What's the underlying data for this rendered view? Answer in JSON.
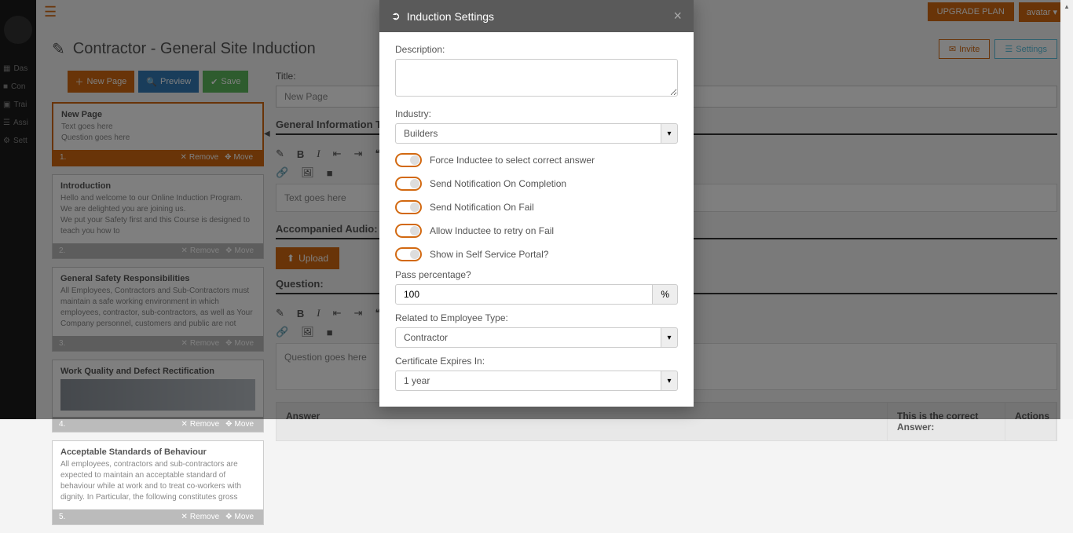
{
  "topbar": {
    "upgrade": "UPGRADE PLAN",
    "avatar": "avatar ▾"
  },
  "sidebar": {
    "items": [
      {
        "icon": "▦",
        "label": "Das"
      },
      {
        "icon": "■",
        "label": "Con"
      },
      {
        "icon": "▣",
        "label": "Trai"
      },
      {
        "icon": "☰",
        "label": "Assi"
      },
      {
        "icon": "⚙",
        "label": "Sett"
      }
    ]
  },
  "page": {
    "title": "Contractor - General Site Induction"
  },
  "title_actions": {
    "invite": "Invite",
    "settings": "Settings"
  },
  "left_toolbar": {
    "new_page": "New Page",
    "preview": "Preview",
    "save": "Save"
  },
  "cards": [
    {
      "num": "1.",
      "title": "New Page",
      "lines": [
        "Text goes here",
        "Question goes here"
      ],
      "active": true
    },
    {
      "num": "2.",
      "title": "Introduction",
      "lines": [
        "Hello and welcome to our Online Induction Program. We are delighted you are joining us.",
        "We put your Safety first and this Course is designed to teach you how to"
      ]
    },
    {
      "num": "3.",
      "title": "General Safety Responsibilities",
      "lines": [
        "All Employees, Contractors and Sub-Contractors must maintain a safe working environment in which employees, contractor, sub-contractors, as well as Your Company personnel, customers and public are not"
      ]
    },
    {
      "num": "4.",
      "title": "Work Quality and Defect Rectification",
      "lines": [],
      "has_image": true
    },
    {
      "num": "5.",
      "title": "Acceptable Standards of Behaviour",
      "lines": [
        "All employees, contractors and sub-contractors are expected to maintain an acceptable standard of behaviour while at work and to treat co-workers with dignity. In Particular, the following constitutes gross"
      ]
    }
  ],
  "card_actions": {
    "remove": "Remove",
    "move": "Move"
  },
  "form": {
    "title_label": "Title:",
    "title_value": "New Page",
    "gen_info_header": "General Information Text:",
    "text_content": "Text goes here",
    "audio_header": "Accompanied Audio:",
    "upload": "Upload",
    "question_header": "Question:",
    "question_content": "Question goes here",
    "answer_header": {
      "answer": "Answer",
      "correct": "This is the correct Answer:",
      "actions": "Actions"
    }
  },
  "modal": {
    "title": "Induction Settings",
    "description_label": "Description:",
    "industry_label": "Industry:",
    "industry_value": "Builders",
    "toggles": [
      "Force Inductee to select correct answer",
      "Send Notification On Completion",
      "Send Notification On Fail",
      "Allow Inductee to retry on Fail",
      "Show in Self Service Portal?"
    ],
    "pass_label": "Pass percentage?",
    "pass_value": "100",
    "pass_unit": "%",
    "emp_type_label": "Related to Employee Type:",
    "emp_type_value": "Contractor",
    "expires_label": "Certificate Expires In:",
    "expires_value": "1 year"
  }
}
